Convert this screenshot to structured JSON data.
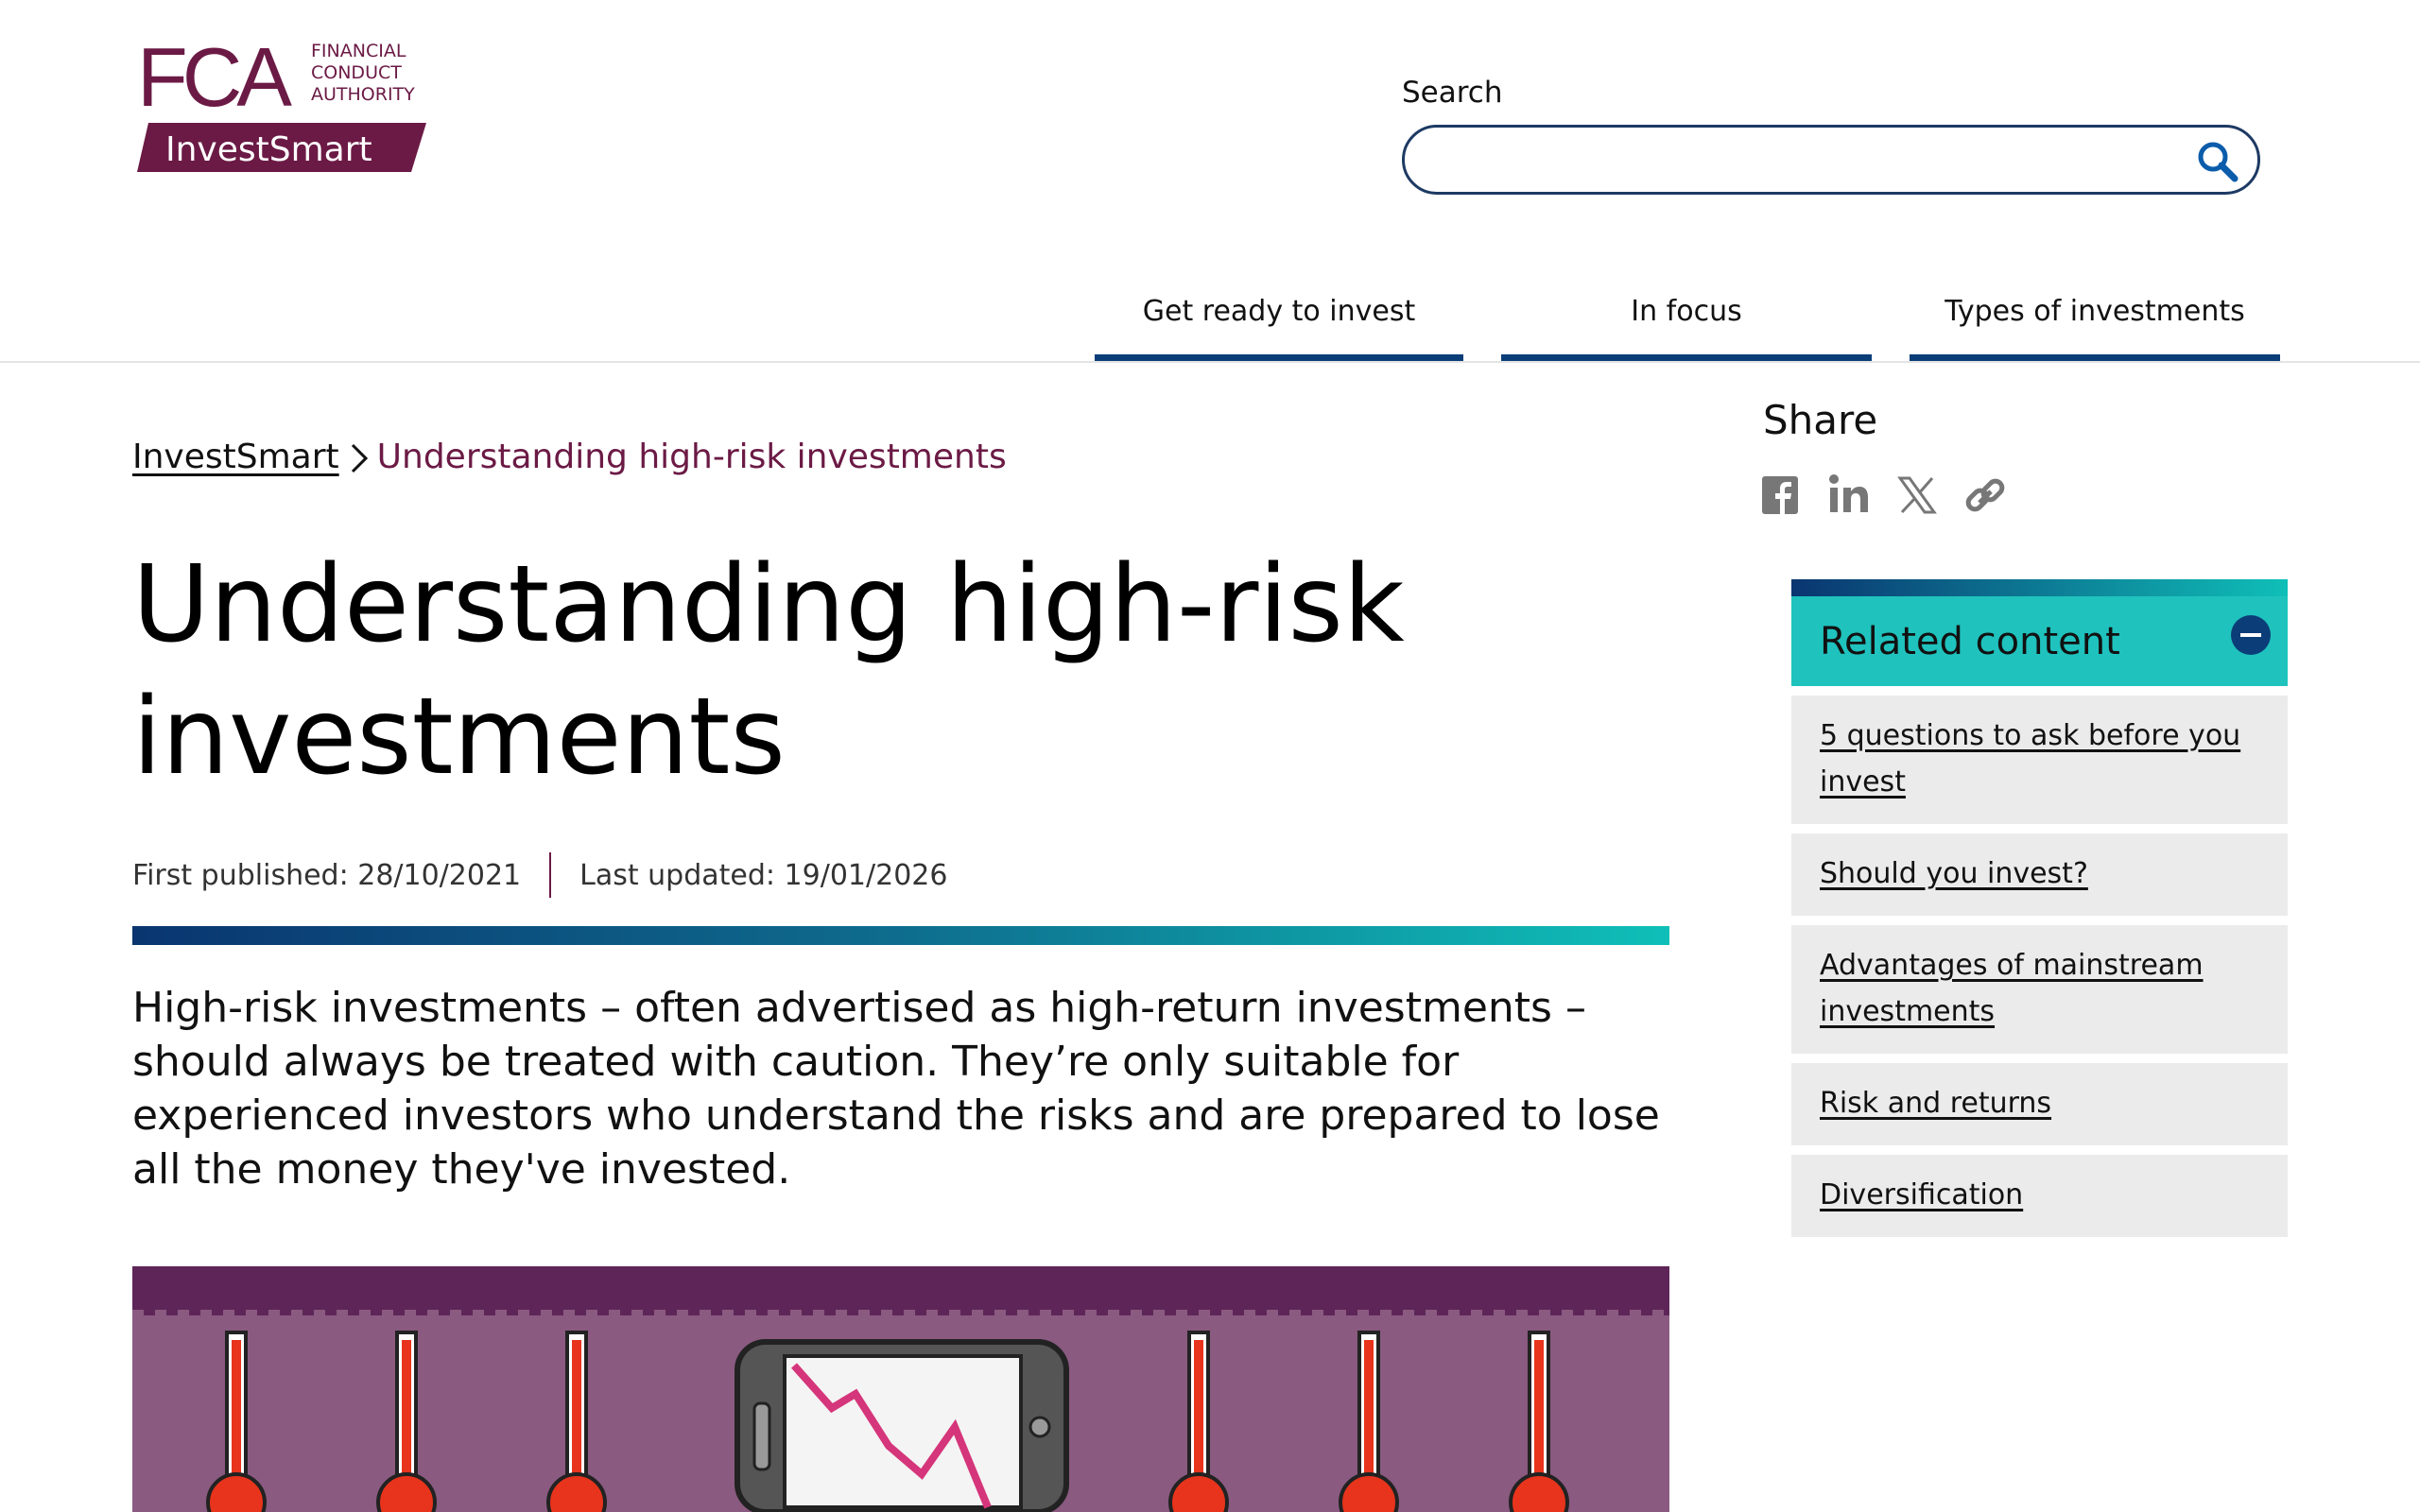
{
  "logo": {
    "letters": "FCA",
    "line1": "FINANCIAL",
    "line2": "CONDUCT",
    "line3": "AUTHORITY",
    "product": "InvestSmart"
  },
  "search": {
    "label": "Search",
    "placeholder": "",
    "value": "",
    "icon": "search-icon"
  },
  "nav": {
    "items": [
      {
        "label": "Get ready to invest"
      },
      {
        "label": "In focus"
      },
      {
        "label": "Types of investments"
      }
    ]
  },
  "breadcrumb": {
    "home": "InvestSmart",
    "current": "Understanding high-risk investments"
  },
  "article": {
    "title": "Understanding high-risk investments",
    "first_published": "First published: 28/10/2021",
    "last_updated": "Last updated: 19/01/2026",
    "intro": "High-risk investments – often advertised as high-return investments – should always be treated with caution. They’re only suitable for experienced investors who understand the risks and are prepared to lose all the money they've invested."
  },
  "share": {
    "title": "Share",
    "icons": [
      "facebook-icon",
      "linkedin-icon",
      "x-icon",
      "link-icon"
    ]
  },
  "related": {
    "title": "Related content",
    "items": [
      {
        "label": "5 questions to ask before you invest"
      },
      {
        "label": "Should you invest?"
      },
      {
        "label": "Advantages of mainstream investments"
      },
      {
        "label": "Risk and returns"
      },
      {
        "label": "Diversification"
      }
    ]
  },
  "colors": {
    "brand_maroon": "#6b1a45",
    "nav_blue": "#0b3d78",
    "teal": "#1fc2bd",
    "hero_purple": "#8a5a80"
  }
}
